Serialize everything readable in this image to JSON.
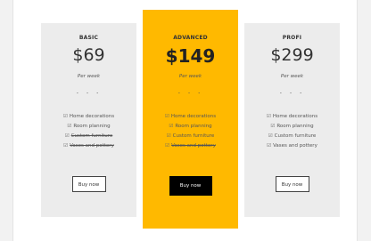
{
  "plans": [
    {
      "name": "BASIC",
      "price": "$69",
      "period": "Per week",
      "dots": ". . .",
      "features": [
        {
          "label": "Home decorations",
          "included": true
        },
        {
          "label": "Room planning",
          "included": true
        },
        {
          "label": "Custom furniture",
          "included": false
        },
        {
          "label": "Vases and pottery",
          "included": false
        }
      ],
      "button": "Buy now"
    },
    {
      "name": "ADVANCED",
      "price": "$149",
      "period": "Per week",
      "dots": ". . .",
      "features": [
        {
          "label": "Home decorations",
          "included": true
        },
        {
          "label": "Room planning",
          "included": true
        },
        {
          "label": "Custom furniture",
          "included": true
        },
        {
          "label": "Vases and pottery",
          "included": false
        }
      ],
      "button": "Buy now"
    },
    {
      "name": "PROFI",
      "price": "$299",
      "period": "Per week",
      "dots": ". . .",
      "features": [
        {
          "label": "Home decorations",
          "included": true
        },
        {
          "label": "Room planning",
          "included": true
        },
        {
          "label": "Custom furniture",
          "included": true
        },
        {
          "label": "Vases and pottery",
          "included": true
        }
      ],
      "button": "Buy now"
    }
  ],
  "check_glyph": "☑",
  "colors": {
    "featured": "#ffb900",
    "card": "#ececec",
    "button_featured": "#000000"
  }
}
